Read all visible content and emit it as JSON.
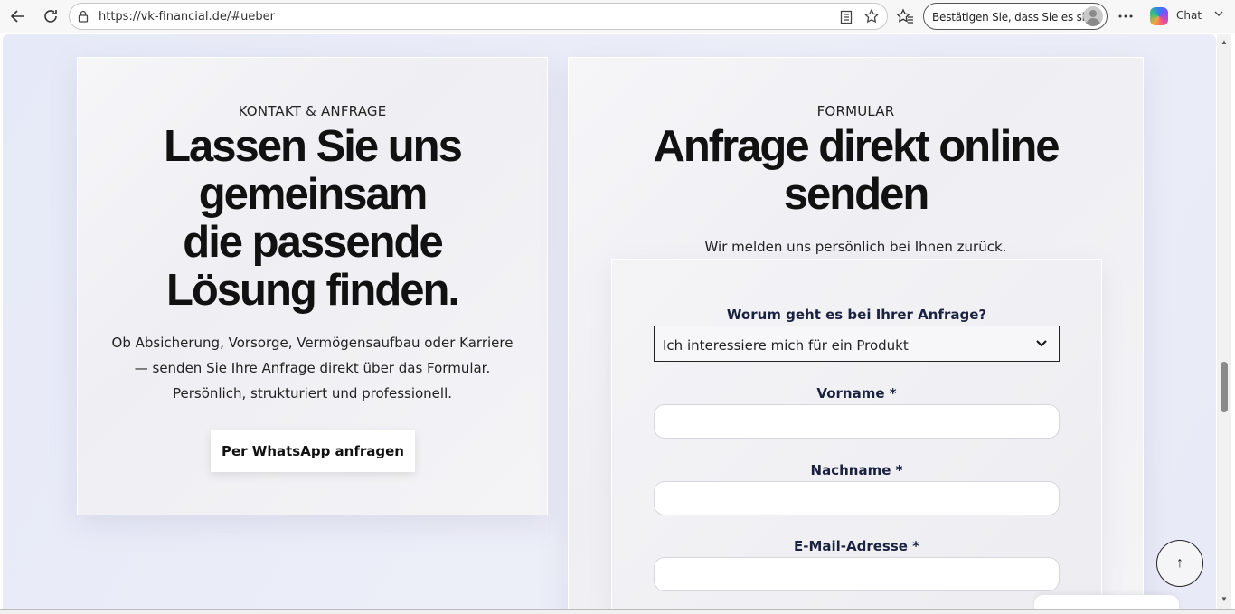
{
  "browser": {
    "url": "https://vk-financial.de/#ueber",
    "profile_label": "Bestätigen Sie, dass Sie es sind",
    "chat_label": "Chat"
  },
  "left_card": {
    "eyebrow": "KONTAKT & ANFRAGE",
    "heading_lines": [
      "Lassen Sie uns",
      "gemeinsam",
      "die passende",
      "Lösung finden."
    ],
    "body_lines": [
      "Ob Absicherung, Vorsorge, Vermögensaufbau oder Karriere",
      "— senden Sie Ihre Anfrage direkt über das Formular.",
      "Persönlich, strukturiert und professionell."
    ],
    "whatsapp_button": "Per WhatsApp anfragen"
  },
  "right_card": {
    "eyebrow": "FORMULAR",
    "heading_lines": [
      "Anfrage direkt online",
      "senden"
    ],
    "subtext": "Wir melden uns persönlich bei Ihnen zurück.",
    "form": {
      "topic_label": "Worum geht es bei Ihrer Anfrage?",
      "topic_value": "Ich interessiere mich für ein Produkt",
      "first_name_label": "Vorname *",
      "first_name_value": "",
      "last_name_label": "Nachname *",
      "last_name_value": "",
      "email_label": "E-Mail-Adresse *",
      "email_value": ""
    }
  },
  "back_to_top": "↑"
}
